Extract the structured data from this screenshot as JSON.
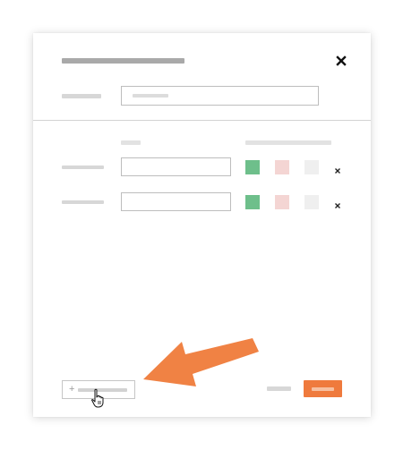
{
  "dialog": {
    "title": "",
    "name_label": "",
    "name_value": "",
    "name_placeholder": ""
  },
  "table": {
    "columns": [
      "",
      ""
    ],
    "rows": [
      {
        "label": "",
        "value": "",
        "colors": [
          "#6ebf8b",
          "#f4d5d3",
          "#efefef"
        ]
      },
      {
        "label": "",
        "value": "",
        "colors": [
          "#6ebf8b",
          "#f4d5d3",
          "#efefef"
        ]
      }
    ]
  },
  "footer": {
    "add_label": "",
    "cancel_label": "",
    "primary_label": ""
  },
  "colors": {
    "accent": "#ef7a3d",
    "arrow": "#f08244",
    "swatch_green": "#6ebf8b",
    "swatch_pink": "#f4d5d3",
    "swatch_gray": "#efefef"
  },
  "icons": {
    "close": "close-icon",
    "row_delete": "close-icon",
    "add": "plus-icon",
    "pointer": "hand-pointer-icon",
    "annotation": "arrow-icon"
  }
}
